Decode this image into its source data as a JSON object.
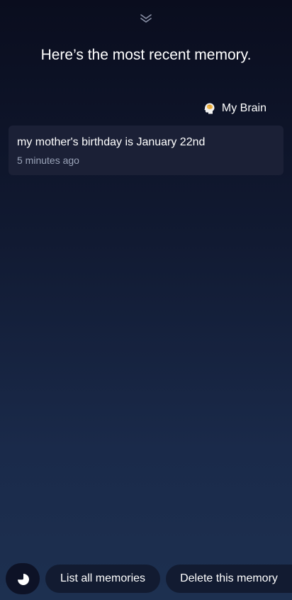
{
  "header": {
    "collapse_icon": "double-chevron-down-icon",
    "title": "Here’s the most recent memory."
  },
  "source": {
    "icon": "brain-icon",
    "label": "My Brain"
  },
  "memory": {
    "text": "my mother's birthday is January 22nd",
    "time": "5 minutes ago"
  },
  "suggestions": [
    {
      "label": "List all memories"
    },
    {
      "label": "Delete this memory"
    }
  ],
  "assistant": {
    "icon": "bixby-icon"
  },
  "colors": {
    "background_top": "#0a0d1e",
    "background_bottom": "#1d3050",
    "card": "#1b2036",
    "chip": "#121b31",
    "secondary_text": "#9aa3b8"
  }
}
